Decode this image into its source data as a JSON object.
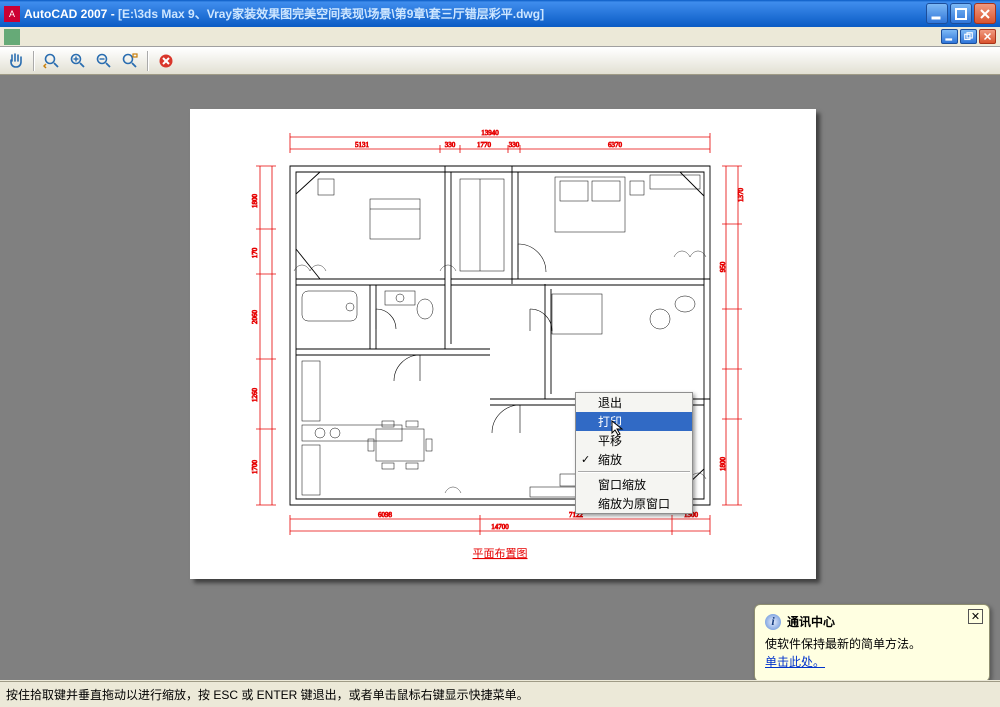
{
  "titlebar": {
    "app": "AutoCAD 2007",
    "separator": " - ",
    "path": "[E:\\3ds Max 9、Vray家装效果图完美空间表现\\场景\\第9章\\套三厅错层彩平.dwg]"
  },
  "toolbar": {
    "buttons": [
      "pan-realtime",
      "zoom-extents-prev",
      "zoom-in",
      "zoom-out",
      "zoom-window"
    ],
    "close_label": "×"
  },
  "drawing": {
    "title": "平面布置图",
    "dims": {
      "top_total": "13940",
      "top_segs": [
        "5131",
        "330",
        "1770",
        "330",
        "6370"
      ],
      "left_segs": [
        "1800",
        "170",
        "2060",
        "1260",
        "1700"
      ],
      "right_top": "1370",
      "right_mid": "950",
      "right_low": "1800",
      "bottom_segs": [
        "6098",
        "7122",
        "1300"
      ],
      "bottom_total": "14700"
    }
  },
  "context_menu": {
    "items": [
      {
        "label": "退出",
        "highlighted": false,
        "checked": false
      },
      {
        "label": "打印",
        "highlighted": true,
        "checked": false
      },
      {
        "label": "平移",
        "highlighted": false,
        "checked": false
      },
      {
        "label": "缩放",
        "highlighted": false,
        "checked": true
      }
    ],
    "items2": [
      {
        "label": "窗口缩放"
      },
      {
        "label": "缩放为原窗口"
      }
    ]
  },
  "notification": {
    "title": "通讯中心",
    "body": "使软件保持最新的简单方法。",
    "link": "单击此处。"
  },
  "statusbar": {
    "text": "按住拾取键并垂直拖动以进行缩放，按 ESC 或 ENTER 键退出，或者单击鼠标右键显示快捷菜单。"
  }
}
